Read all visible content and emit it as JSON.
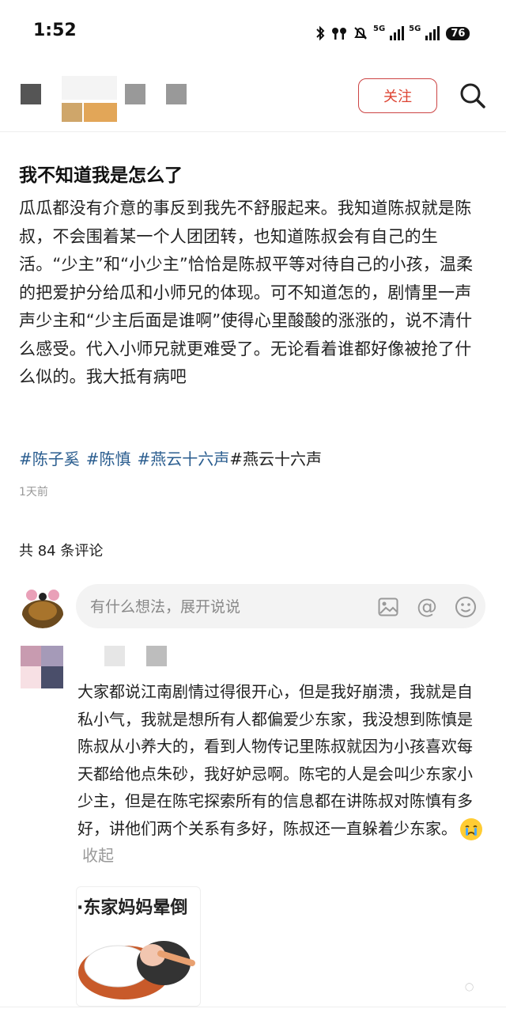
{
  "status_bar": {
    "time": "1:52",
    "network1": "5G",
    "network2": "5G",
    "battery": "76"
  },
  "header": {
    "follow_label": "关注"
  },
  "post": {
    "title": "我不知道我是怎么了",
    "body": "瓜瓜都没有介意的事反到我先不舒服起来。我知道陈叔就是陈叔，不会围着某一个人团团转，也知道陈叔会有自己的生活。“少主”和“小少主”恰恰是陈叔平等对待自己的小孩，温柔的把爱护分给瓜和小师兄的体现。可不知道怎的，剧情里一声声少主和“少主后面是谁啊”使得心里酸酸的涨涨的，说不清什么感受。代入小师兄就更难受了。无论看着谁都好像被抢了什么似的。我大抵有病吧",
    "hashtags": [
      "#陈子奚",
      "#陈慎",
      "#燕云十六声",
      "#燕云十六声"
    ],
    "time": "1天前"
  },
  "comments": {
    "count_label": "共 84 条评论",
    "input_placeholder": "有什么想法，展开说说",
    "first": {
      "body": "大家都说江南剧情过得很开心，但是我好崩溃，我就是自私小气，我就是想所有人都偏爱少东家，我没想到陈慎是陈叔从小养大的，看到人物传记里陈叔就因为小孩喜欢每天都给他点朱砂，我好妒忌啊。陈宅的人是会叫少东家小少主，但是在陈宅探索所有的信息都在讲陈叔对陈慎有多好，讲他们两个关系有多好，陈叔还一直躲着少东家。",
      "collapse_label": "收起",
      "sticker_text": "·东家妈妈晕倒"
    }
  },
  "icons": {
    "search": "search-icon",
    "image": "image-icon",
    "at": "at-icon",
    "emoji": "emoji-icon",
    "bluetooth": "bluetooth-icon",
    "earbuds": "earbuds-icon",
    "mute": "bell-off-icon"
  },
  "colors": {
    "accent": "#d43f3f",
    "hashtag": "#2a5d8f",
    "muted": "#999999"
  }
}
